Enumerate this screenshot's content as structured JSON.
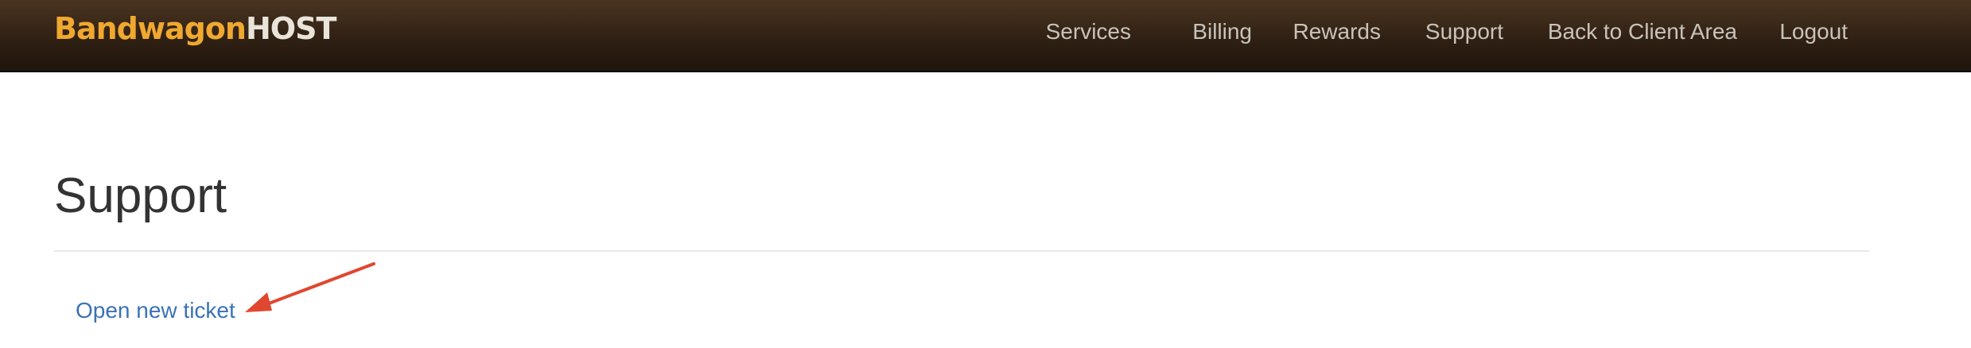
{
  "brand": {
    "name_part1": "Bandwagon",
    "name_part2": "HOST",
    "colors": {
      "part1": "#f0a830",
      "part2": "#e9e4da"
    }
  },
  "nav": {
    "items": [
      {
        "label": "Services"
      },
      {
        "label": "Billing"
      },
      {
        "label": "Rewards"
      },
      {
        "label": "Support"
      },
      {
        "label": "Back to Client Area"
      },
      {
        "label": "Logout"
      }
    ]
  },
  "main": {
    "title": "Support",
    "open_ticket_link": "Open new ticket"
  },
  "annotation": {
    "arrow_color": "#e0472f",
    "arrow_icon": "arrow-pointer-icon"
  },
  "colors": {
    "topbar": "#2e1f13",
    "link": "#3a72b6",
    "title": "#333333"
  }
}
